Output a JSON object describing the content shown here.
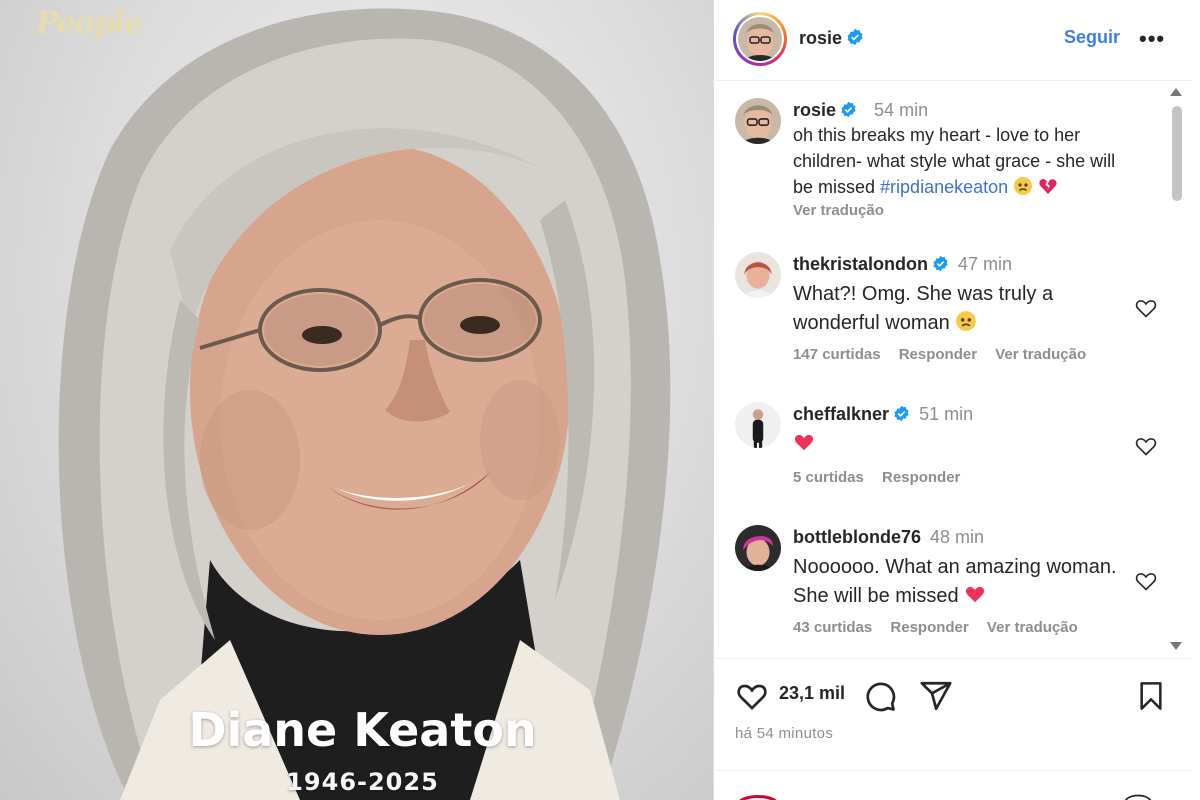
{
  "photo": {
    "brand": "People",
    "name": "Diane Keaton",
    "years": "1946-2025"
  },
  "header": {
    "username": "rosie",
    "follow_label": "Seguir",
    "more_label": "•••"
  },
  "caption": {
    "username": "rosie",
    "time": "54 min",
    "text": "oh this breaks my heart - love to her children- what style what grace - she will be missed ",
    "hashtag": "#ripdianekeaton",
    "translate": "Ver tradução"
  },
  "comments": [
    {
      "username": "thekristalondon",
      "verified": true,
      "time": "47 min",
      "text": "What?! Omg. She was truly a wonderful woman",
      "likes": "147 curtidas",
      "reply": "Responder",
      "translate": "Ver tradução"
    },
    {
      "username": "cheffalkner",
      "verified": true,
      "time": "51 min",
      "text": "",
      "likes": "5 curtidas",
      "reply": "Responder",
      "translate": ""
    },
    {
      "username": "bottleblonde76",
      "verified": false,
      "time": "48 min",
      "text": "Noooooo. What an amazing woman. She will be missed",
      "likes": "43 curtidas",
      "reply": "Responder",
      "translate": "Ver tradução"
    }
  ],
  "actions": {
    "likes": "23,1 mil",
    "posted": "há 54 minutos"
  },
  "colors": {
    "accent_link": "#3f7ee8",
    "verified_badge": "#1d9bf0",
    "muted_text": "#8e8e8e"
  },
  "icons": [
    "heart-icon",
    "comment-icon",
    "share-icon",
    "bookmark-icon",
    "verified-badge-icon",
    "more-icon"
  ]
}
